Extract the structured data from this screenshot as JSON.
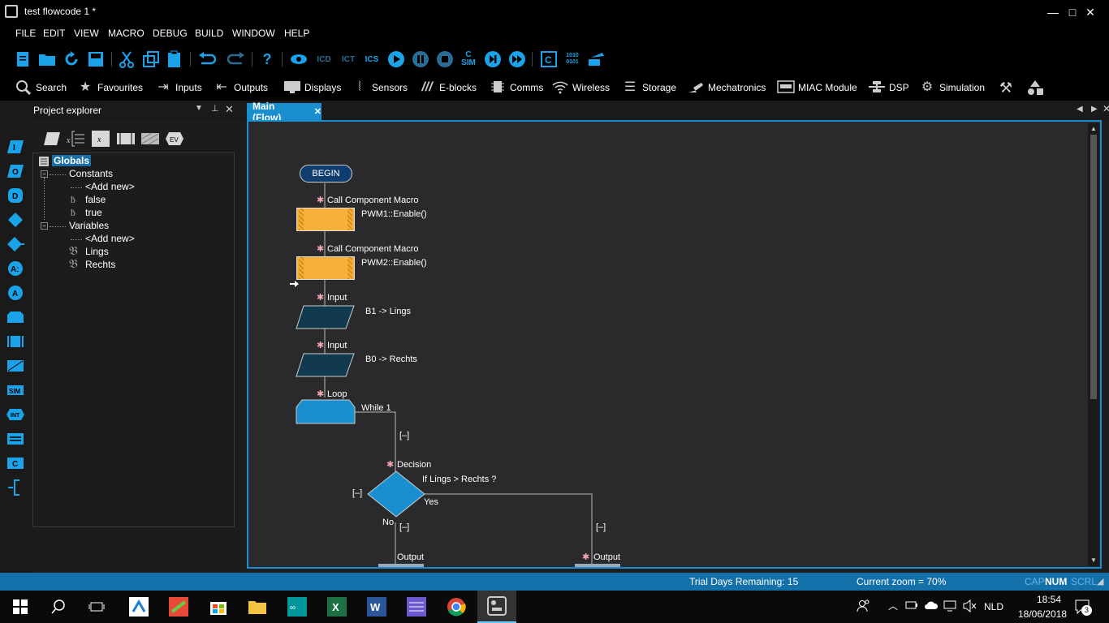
{
  "window": {
    "title": "test flowcode 1 *",
    "min": "—",
    "max": "□",
    "close": "✕"
  },
  "menu": [
    "FILE",
    "EDIT",
    "VIEW",
    "MACRO",
    "DEBUG",
    "BUILD",
    "WINDOW",
    "HELP"
  ],
  "categories": [
    {
      "label": "Search",
      "icon": "search-icon"
    },
    {
      "label": "Favourites",
      "icon": "star-icon"
    },
    {
      "label": "Inputs",
      "icon": "inputs-icon"
    },
    {
      "label": "Outputs",
      "icon": "outputs-icon"
    },
    {
      "label": "Displays",
      "icon": "display-icon"
    },
    {
      "label": "Sensors",
      "icon": "sensors-icon"
    },
    {
      "label": "E-blocks",
      "icon": "eblocks-icon"
    },
    {
      "label": "Comms",
      "icon": "chip-icon"
    },
    {
      "label": "Wireless",
      "icon": "wifi-icon"
    },
    {
      "label": "Storage",
      "icon": "storage-icon"
    },
    {
      "label": "Mechatronics",
      "icon": "mechatronics-icon"
    },
    {
      "label": "MIAC Module",
      "icon": "miac-icon"
    },
    {
      "label": "DSP",
      "icon": "dsp-icon"
    },
    {
      "label": "Simulation",
      "icon": "gear-icon"
    }
  ],
  "project_explorer": {
    "title": "Project explorer",
    "root": "Globals",
    "constants_label": "Constants",
    "constants": [
      "<Add new>",
      "false",
      "true"
    ],
    "variables_label": "Variables",
    "variables": [
      "<Add new>",
      "Lings",
      "Rechts"
    ]
  },
  "tab": {
    "label": "Main (Flow)",
    "close": "✕"
  },
  "flow": {
    "begin": "BEGIN",
    "call1_title": "Call Component Macro",
    "call1_text": "PWM1::Enable()",
    "call2_title": "Call Component Macro",
    "call2_text": "PWM2::Enable()",
    "input1_title": "Input",
    "input1_text": "B1 -> Lings",
    "input2_title": "Input",
    "input2_text": "B0 -> Rechts",
    "loop_title": "Loop",
    "loop_text": "While 1",
    "decision_title": "Decision",
    "decision_text": "If  Lings > Rechts ?",
    "yes": "Yes",
    "no": "No",
    "collapse": "[–]",
    "output_left": "Output",
    "output_right": "Output"
  },
  "status": {
    "trial": "Trial Days Remaining: 15",
    "zoom": "Current zoom = 70%",
    "cap": "CAP",
    "num": "NUM",
    "scrl": "SCRL"
  },
  "tray": {
    "lang": "NLD",
    "time": "18:54",
    "date": "18/06/2018",
    "notifications": "3"
  },
  "colors": {
    "accent": "#1a8fd0",
    "macro": "#f7b13a",
    "input": "#123a4e",
    "loop": "#1a8fd0"
  }
}
